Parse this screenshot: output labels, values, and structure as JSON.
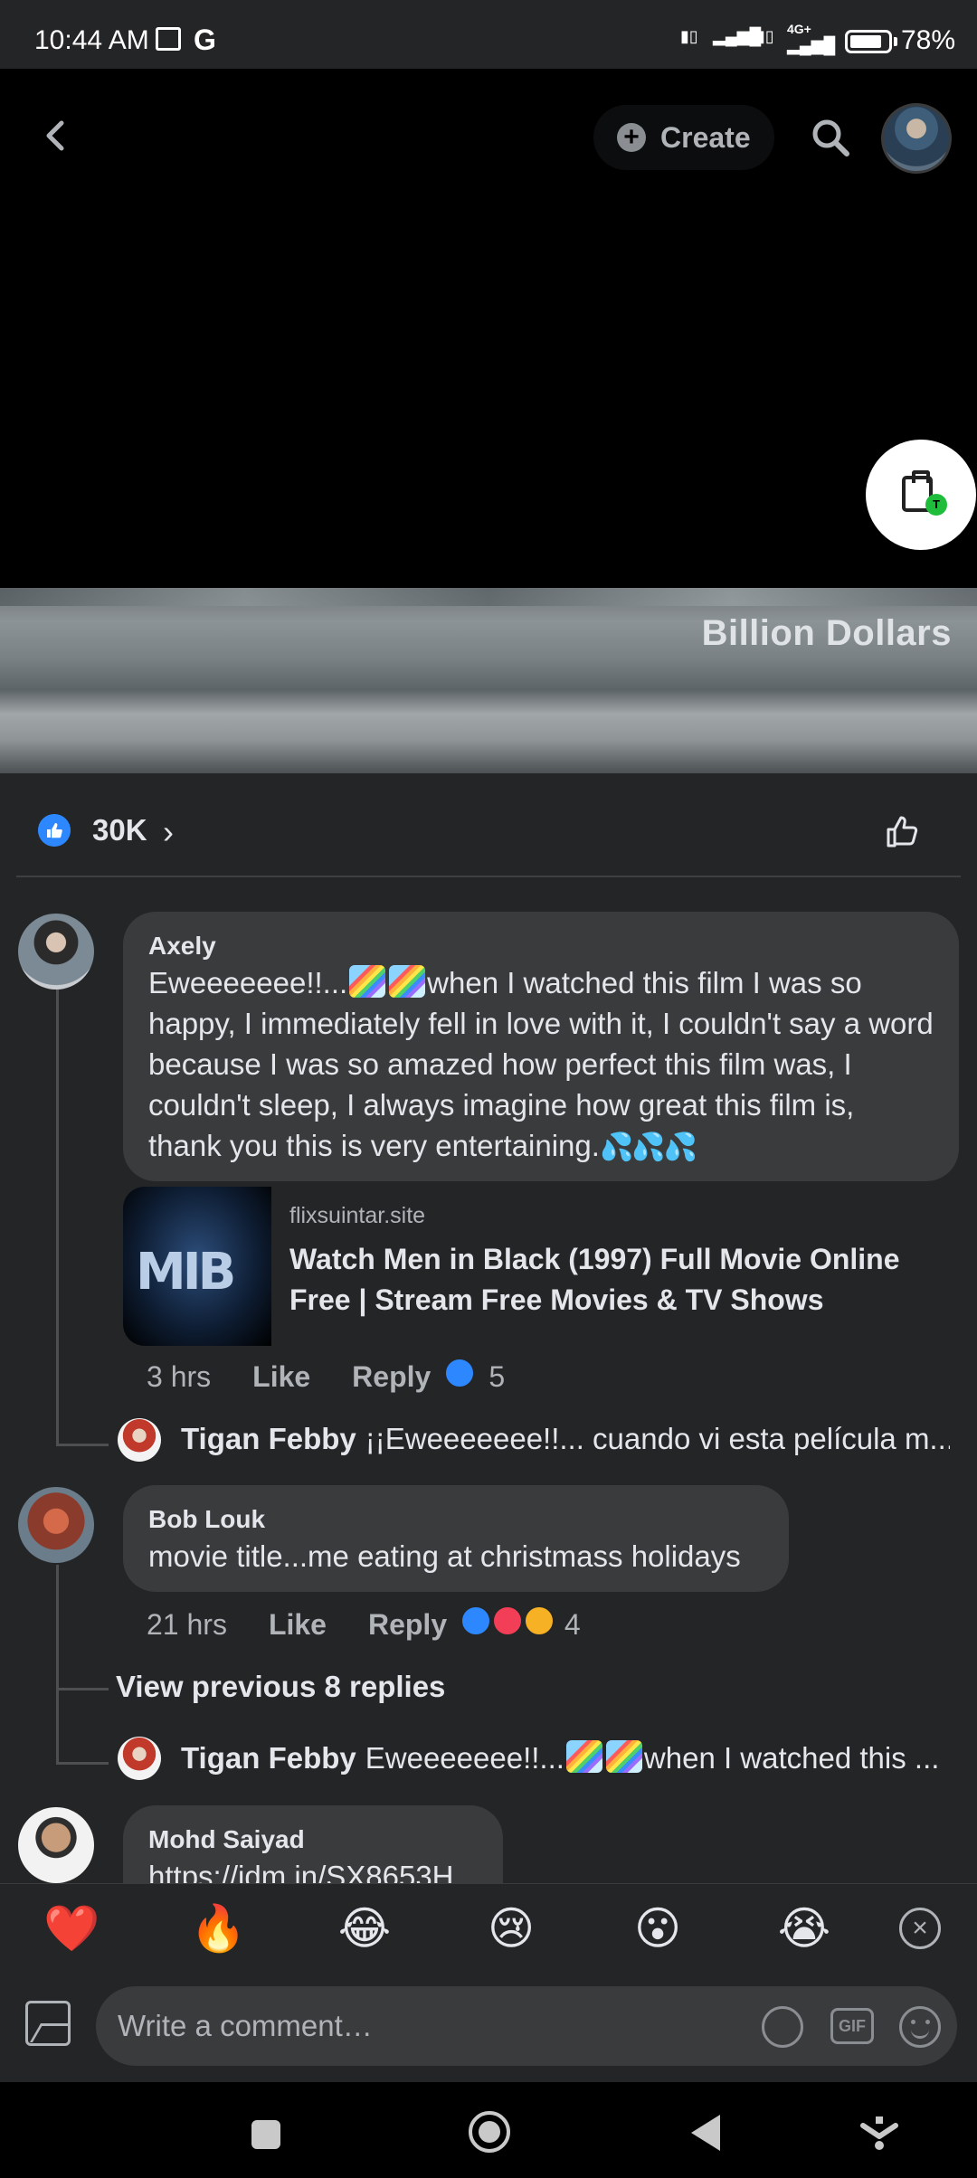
{
  "status_bar": {
    "time": "10:44 AM",
    "carrier_g": "G",
    "network": "4G+",
    "battery_pct": "78%"
  },
  "header": {
    "create_label": "Create",
    "float_badge": "T"
  },
  "video": {
    "caption": "Billion Dollars"
  },
  "reactions": {
    "like_count": "30K"
  },
  "comments": {
    "axely": {
      "author": "Axely",
      "text_prefix": "Eweeeeeee!!...",
      "text_body": "when I watched this film I was so happy, I immediately fell in love with it, I couldn't say a word because I was so amazed how perfect this film was, I couldn't sleep, I always imagine how great this film is, thank you this is very entertaining.",
      "link": {
        "domain": "flixsuintar.site",
        "title": "Watch Men in Black (1997) Full Movie Online Free | Stream Free Movies & TV Shows",
        "thumb_text": "MIB"
      },
      "time": "3 hrs",
      "like_label": "Like",
      "reply_label": "Reply",
      "reaction_count": "5"
    },
    "tigan_reply_1": {
      "name": "Tigan Febby",
      "text": "¡¡Eweeeeeee!!... cuando vi esta película m..."
    },
    "bob": {
      "author": "Bob Louk",
      "text": "movie title...me eating at christmass holidays",
      "time": "21 hrs",
      "like_label": "Like",
      "reply_label": "Reply",
      "reaction_count": "4"
    },
    "view_previous": "View previous 8 replies",
    "tigan_reply_2": {
      "name": "Tigan Febby",
      "text_prefix": "Eweeeeeee!!...",
      "text_suffix": "when I watched this ..."
    },
    "mohd": {
      "author": "Mohd Saiyad",
      "link_text": "https://idm.in/SX8653H"
    }
  },
  "emoji_bar": [
    "❤️",
    "🔥",
    "😂",
    "😢",
    "😮",
    "😭"
  ],
  "composer": {
    "placeholder": "Write a comment…",
    "gif_label": "GIF"
  },
  "colors": {
    "accent": "#2d88ff",
    "background": "#242526",
    "bubble": "#3a3b3c"
  }
}
